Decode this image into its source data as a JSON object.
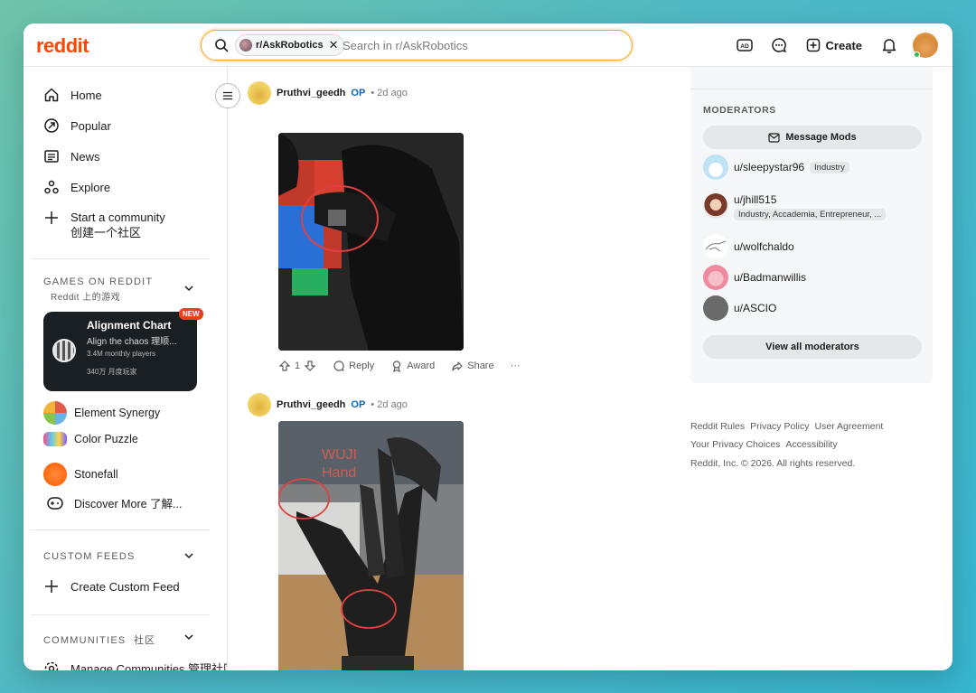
{
  "header": {
    "logo": "reddit",
    "search_chip": "r/AskRobotics",
    "search_placeholder": "Search in r/AskRobotics",
    "create_label": "Create"
  },
  "sidebar": {
    "nav": [
      {
        "label": "Home",
        "icon": "home-icon"
      },
      {
        "label": "Popular",
        "icon": "popular-icon"
      },
      {
        "label": "News",
        "icon": "news-icon"
      },
      {
        "label": "Explore",
        "icon": "explore-icon"
      },
      {
        "label": "Start a community 创建一个社区",
        "icon": "plus-icon"
      }
    ],
    "games_header": "GAMES ON REDDIT",
    "games_sub": "Reddit 上的游戏",
    "featured_game": {
      "title": "Alignment Chart",
      "badge": "NEW",
      "subtitle": "Align the chaos  理顺...",
      "meta1": "3.4M monthly players",
      "meta2": "340万 月度玩家"
    },
    "games": [
      {
        "label": "Element Synergy",
        "icon": "element-synergy-icon"
      },
      {
        "label": "Color Puzzle",
        "icon": "color-puzzle-icon"
      },
      {
        "label": "Stonefall",
        "icon": "stonefall-icon"
      },
      {
        "label": "Discover More  了解...",
        "icon": "gamepad-icon"
      }
    ],
    "custom_feeds_header": "CUSTOM FEEDS",
    "create_feed": "Create Custom Feed",
    "communities_header": "COMMUNITIES",
    "communities_cn": "社区",
    "manage_communities": "Manage Communities  管理社区"
  },
  "feed": {
    "comments": [
      {
        "user": "Pruthvi_geedh",
        "op": "OP",
        "age": "• 2d ago"
      },
      {
        "user": "Pruthvi_geedh",
        "op": "OP",
        "age": "• 2d ago"
      }
    ],
    "actions": {
      "votes": "1",
      "reply": "Reply",
      "award": "Award",
      "share": "Share",
      "more": "···"
    },
    "image2_overlay": "WUJI Hand"
  },
  "rail": {
    "moderators_header": "MODERATORS",
    "message_mods": "Message Mods",
    "moderators": [
      {
        "name": "u/sleepystar96",
        "flair": "Industry"
      },
      {
        "name": "u/jhill515",
        "flair": "Industry, Accademia, Entrepreneur, ..."
      },
      {
        "name": "u/wolfchaldo",
        "flair": ""
      },
      {
        "name": "u/Badmanwillis",
        "flair": ""
      },
      {
        "name": "u/ASCIO",
        "flair": ""
      }
    ],
    "view_all": "View all moderators",
    "footer": {
      "rules": "Reddit Rules",
      "privacy": "Privacy Policy",
      "agreement": "User Agreement",
      "choices": "Your Privacy Choices",
      "accessibility": "Accessibility",
      "copyright": "Reddit, Inc. © 2026. All rights reserved."
    }
  },
  "colors": {
    "brand": "#ff4500",
    "search_border": "#f5a623",
    "op": "#0a66c2",
    "badge": "#e8401c"
  }
}
